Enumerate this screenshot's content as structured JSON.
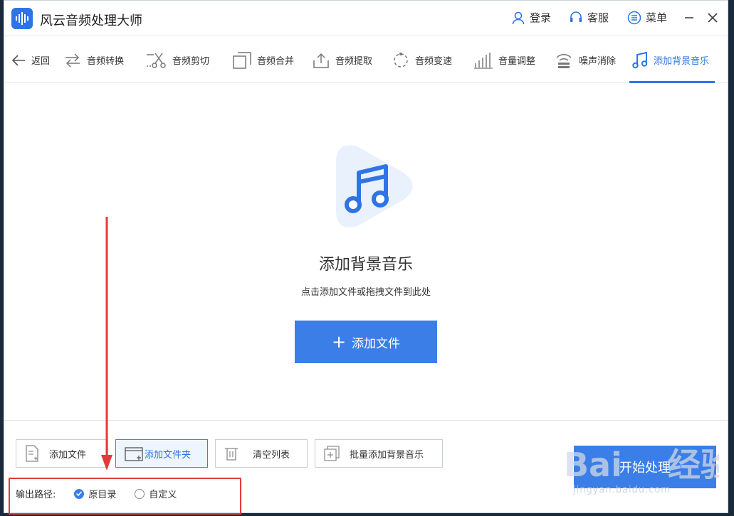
{
  "window": {
    "title": "风云音频处理大师",
    "actions": {
      "login": "登录",
      "service": "客服",
      "menu": "菜单"
    }
  },
  "tabs": [
    {
      "label": "返回",
      "icon": "arrow-left-icon"
    },
    {
      "label": "音频转换",
      "icon": "convert-icon"
    },
    {
      "label": "音频剪切",
      "icon": "scissors-icon"
    },
    {
      "label": "音频合并",
      "icon": "merge-icon"
    },
    {
      "label": "音频提取",
      "icon": "extract-icon"
    },
    {
      "label": "音频变速",
      "icon": "speed-icon"
    },
    {
      "label": "音量调整",
      "icon": "volume-icon"
    },
    {
      "label": "噪声消除",
      "icon": "noise-icon"
    },
    {
      "label": "添加背景音乐",
      "icon": "music-note-icon",
      "active": true
    }
  ],
  "drop_zone": {
    "title": "添加背景音乐",
    "hint": "点击添加文件或拖拽文件到此处",
    "add_button": "添加文件"
  },
  "bottom_buttons": {
    "add_file": "添加文件",
    "add_folder": "添加文件夹",
    "clear_list": "清空列表",
    "batch_add": "批量添加背景音乐",
    "start": "开始处理"
  },
  "output": {
    "label": "输出路径:",
    "options": [
      {
        "label": "原目录",
        "checked": true
      },
      {
        "label": "自定义",
        "checked": false
      }
    ]
  },
  "watermark": "jingyan.baidu.com",
  "colors": {
    "accent": "#3b7ee8",
    "annotation": "#e23b3b"
  }
}
